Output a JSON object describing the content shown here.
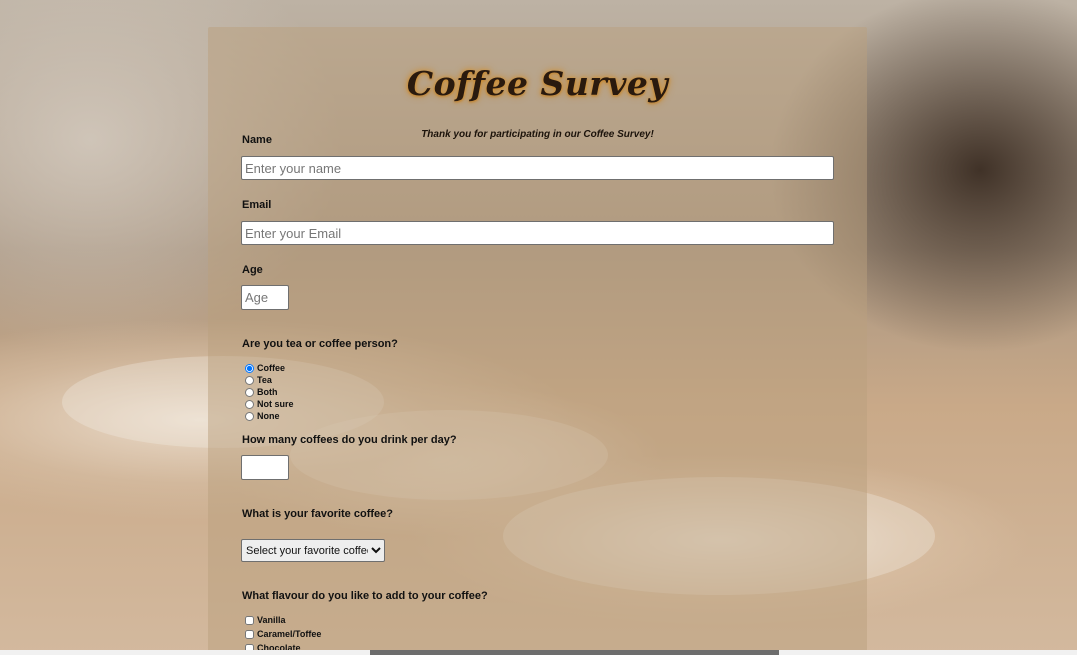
{
  "form": {
    "title": "Coffee Survey",
    "subtitle": "Thank you for participating in our Coffee Survey!",
    "name": {
      "label": "Name",
      "placeholder": "Enter your name",
      "value": ""
    },
    "email": {
      "label": "Email",
      "placeholder": "Enter your Email",
      "value": ""
    },
    "age": {
      "label": "Age",
      "placeholder": "Age",
      "value": ""
    },
    "preference": {
      "label": "Are you tea or coffee person?",
      "options": [
        "Coffee",
        "Tea",
        "Both",
        "Not sure",
        "None"
      ],
      "selected": "Coffee"
    },
    "coffees_per_day": {
      "label": "How many coffees do you drink per day?",
      "value": ""
    },
    "favorite": {
      "label": "What is your favorite coffee?",
      "selected": "Select your favorite coffee"
    },
    "flavour": {
      "label": "What flavour do you like to add to your coffee?",
      "options": [
        "Vanilla",
        "Caramel/Toffee",
        "Chocolate"
      ]
    }
  }
}
